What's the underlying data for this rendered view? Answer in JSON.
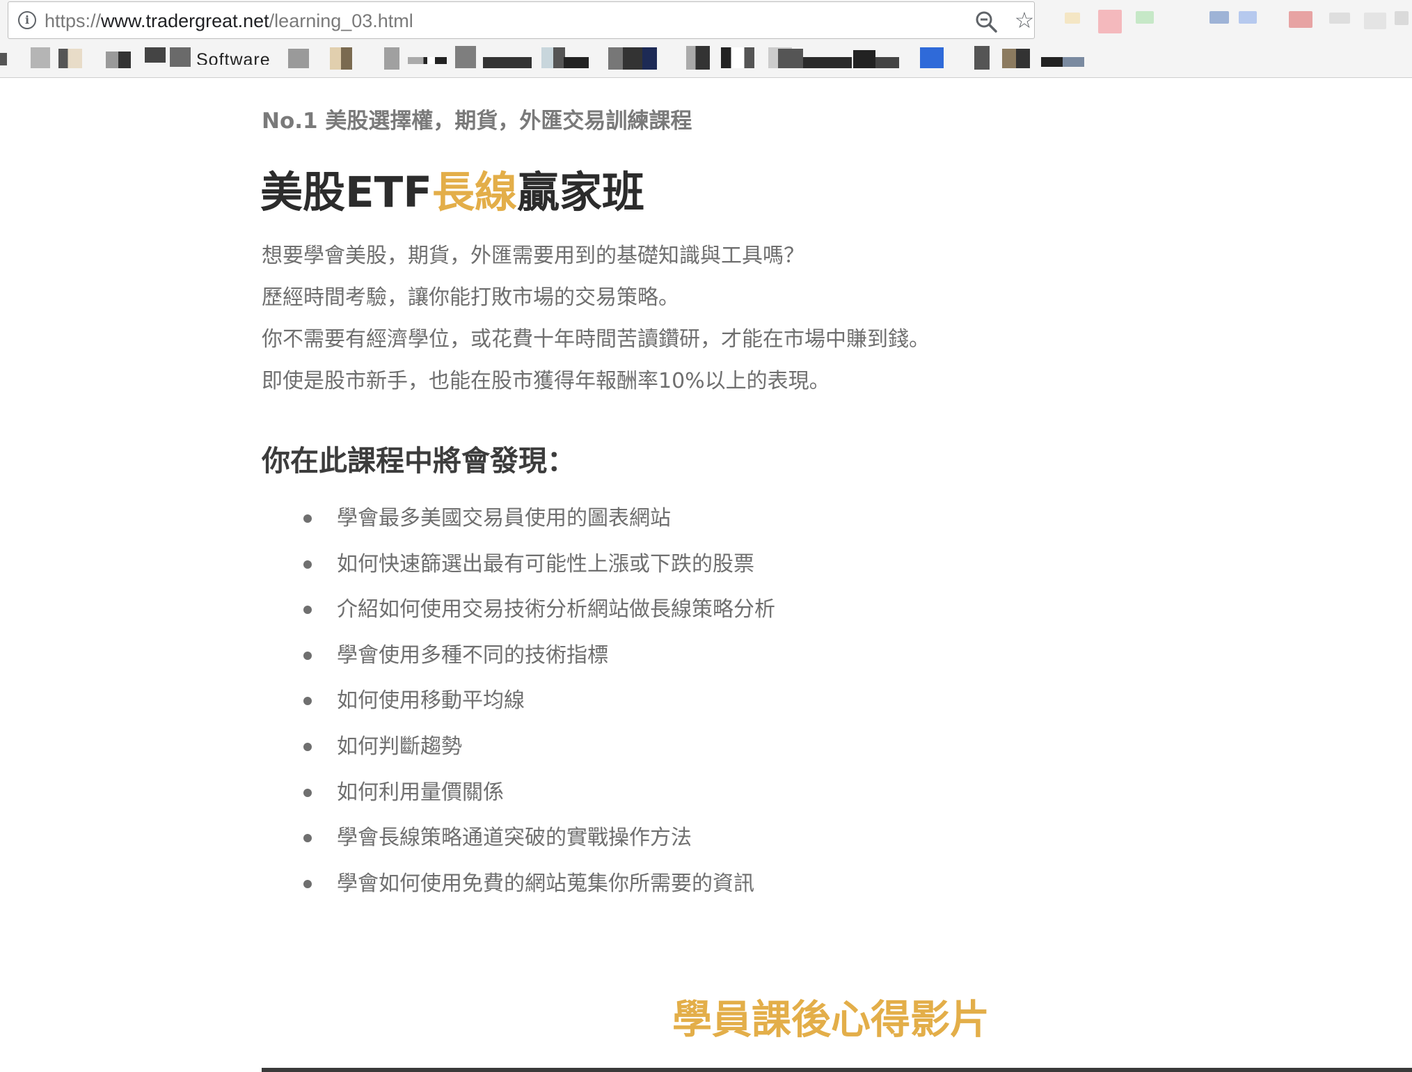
{
  "browser": {
    "url_scheme": "https://",
    "url_host": "www.tradergreat.net",
    "url_path": "/learning_03.html",
    "bookmark_text": "Software"
  },
  "page": {
    "tagline": "No.1 美股選擇權，期貨，外匯交易訓練課程",
    "title_before": "美股ETF",
    "title_accent": "長線",
    "title_after": "贏家班",
    "intro_lines": [
      "想要學會美股，期貨，外匯需要用到的基礎知識與工具嗎？",
      "歷經時間考驗，讓你能打敗市場的交易策略。",
      "你不需要有經濟學位，或花費十年時間苦讀鑽研，才能在市場中賺到錢。",
      "即使是股市新手，也能在股市獲得年報酬率10%以上的表現。"
    ],
    "section_heading": "你在此課程中將會發現：",
    "features": [
      "學會最多美國交易員使用的圖表網站",
      "如何快速篩選出最有可能性上漲或下跌的股票",
      "介紹如何使用交易技術分析網站做長線策略分析",
      "學會使用多種不同的技術指標",
      "如何使用移動平均線",
      "如何判斷趨勢",
      "如何利用量價關係",
      "學會長線策略通道突破的實戰操作方法",
      "學會如何使用免費的網站蒐集你所需要的資訊"
    ],
    "video_heading": "學員課後心得影片"
  },
  "colors": {
    "accent": "#e3ae49",
    "body_text": "#6f6f6f",
    "heading_text": "#2c2c2c"
  },
  "icons": {
    "info": "info-icon",
    "zoom": "zoom-out-icon",
    "bookmark_star": "star-icon"
  }
}
